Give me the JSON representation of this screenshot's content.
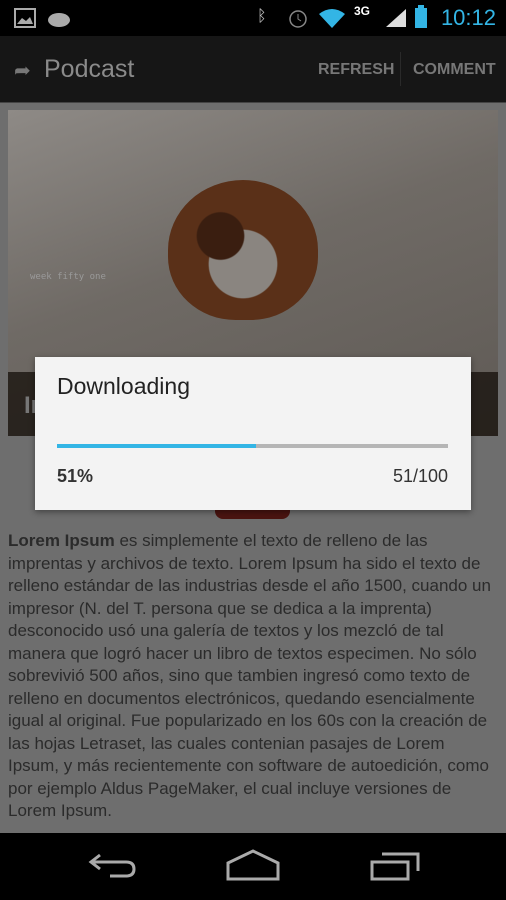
{
  "status_bar": {
    "time": "10:12",
    "icons": [
      "image-icon",
      "android-icon",
      "bluetooth-icon",
      "alarm-icon",
      "wifi-icon",
      "3g-icon",
      "signal-icon",
      "battery-charging-icon"
    ]
  },
  "action_bar": {
    "title": "Podcast",
    "refresh": "REFRESH",
    "comment": "COMMENT"
  },
  "hero": {
    "watermark": "week fifty one",
    "caption": "In"
  },
  "article": {
    "lead": "Lorem Ipsum",
    "text": " es simplemente el texto de relleno de las imprentas y archivos de texto. Lorem Ipsum ha sido el texto de relleno estándar de las industrias desde el año 1500, cuando un impresor (N. del T. persona que se dedica a la imprenta) desconocido usó una galería de textos y los mezcló de tal manera que logró hacer un libro de textos especimen. No sólo sobrevivió 500 años, sino que tambien ingresó como texto de relleno en documentos electrónicos, quedando esencialmente igual al original. Fue popularizado en los 60s con la creación de las hojas Letraset, las cuales contenian pasajes de Lorem Ipsum, y más recientemente con software de autoedición, como por ejemplo Aldus PageMaker, el cual incluye versiones de Lorem Ipsum."
  },
  "dialog": {
    "title": "Downloading",
    "percent_label": "51%",
    "count_label": "51/100",
    "progress": 0.51,
    "accent": "#33b5e5"
  }
}
